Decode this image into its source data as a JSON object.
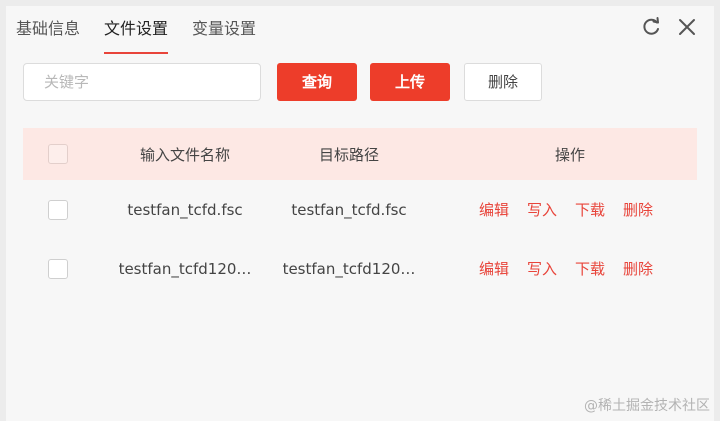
{
  "tabs": [
    {
      "label": "基础信息",
      "active": false
    },
    {
      "label": "文件设置",
      "active": true
    },
    {
      "label": "变量设置",
      "active": false
    }
  ],
  "window_icons": [
    "refresh-icon",
    "close-icon"
  ],
  "toolbar": {
    "search_placeholder": "关键字",
    "query_label": "查询",
    "upload_label": "上传",
    "delete_label": "删除"
  },
  "table": {
    "headers": {
      "name": "输入文件名称",
      "path": "目标路径",
      "ops": "操作"
    },
    "rows": [
      {
        "name": "testfan_tcfd.fsc",
        "path": "testfan_tcfd.fsc"
      },
      {
        "name": "testfan_tcfd120…",
        "path": "testfan_tcfd120…"
      }
    ],
    "ops": [
      "编辑",
      "写入",
      "下载",
      "删除"
    ]
  },
  "watermark": "@稀土掘金技术社区",
  "colors": {
    "accent": "#ed3d2a",
    "header_bg": "#fde8e4"
  }
}
